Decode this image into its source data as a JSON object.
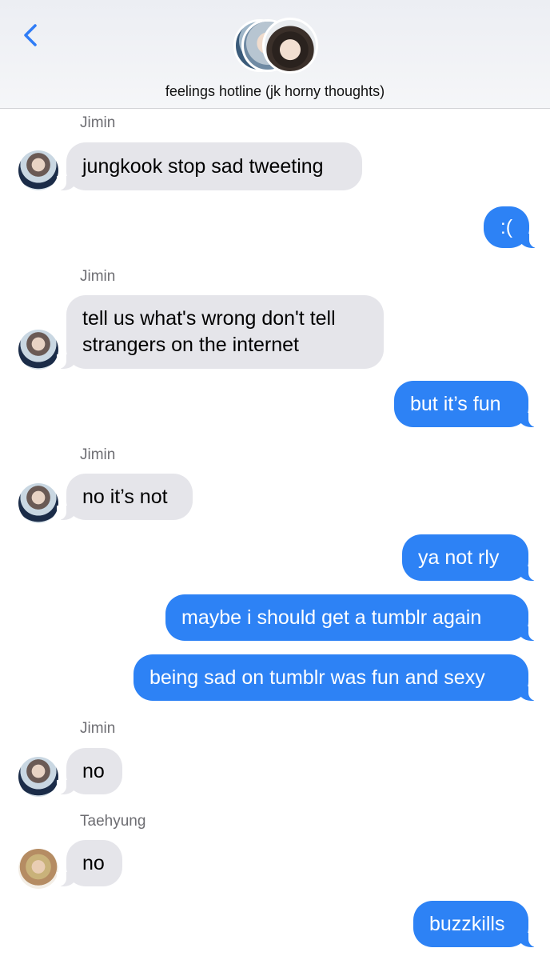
{
  "header": {
    "title": "feelings hotline (jk horny thoughts)",
    "back_icon": "chevron-left-icon"
  },
  "colors": {
    "sent_bubble": "#2d82f5",
    "received_bubble": "#e5e5ea",
    "accent": "#2f7cf6"
  },
  "messages": [
    {
      "sender": "Jimin",
      "direction": "received",
      "text": "jungkook stop sad tweeting"
    },
    {
      "direction": "sent",
      "text": ":("
    },
    {
      "sender": "Jimin",
      "direction": "received",
      "text": "tell us what's wrong don't tell\nstrangers on the internet"
    },
    {
      "direction": "sent",
      "text": "but it’s fun"
    },
    {
      "sender": "Jimin",
      "direction": "received",
      "text": "no it’s not"
    },
    {
      "direction": "sent",
      "text": "ya not rly"
    },
    {
      "direction": "sent",
      "text": "maybe i should get a tumblr again"
    },
    {
      "direction": "sent",
      "text": "being sad on tumblr was fun and sexy"
    },
    {
      "sender": "Jimin",
      "direction": "received",
      "text": "no"
    },
    {
      "sender": "Taehyung",
      "direction": "received",
      "text": "no"
    },
    {
      "direction": "sent",
      "text": "buzzkills"
    }
  ]
}
